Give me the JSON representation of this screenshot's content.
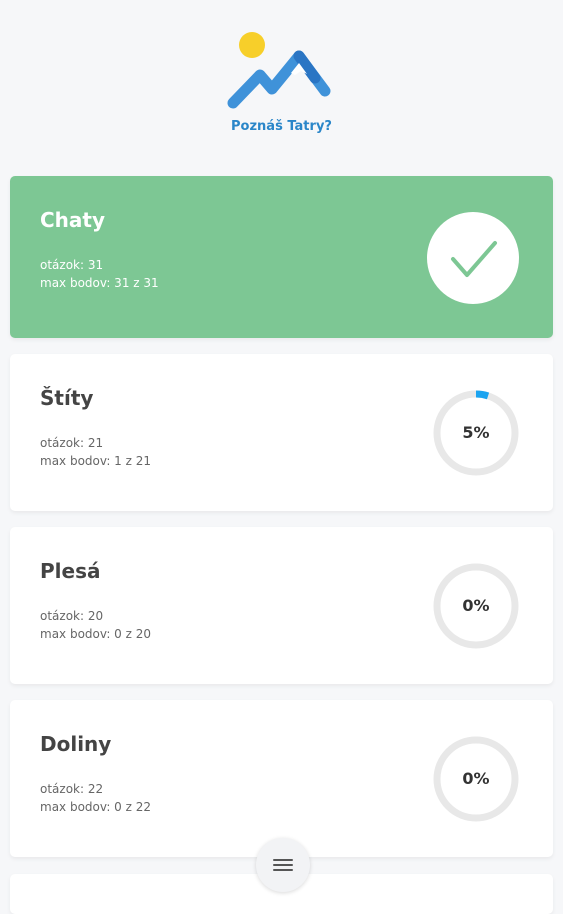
{
  "app": {
    "title": "Poznáš Tatry?"
  },
  "colors": {
    "accent": "#2a86c9",
    "done_card": "#7dc794",
    "check": "#7dc794",
    "progress": "#1aa3f0",
    "ring_track": "#e8e8e8"
  },
  "icons": {
    "logo": "mountain-sun-logo",
    "check": "check-icon",
    "menu": "hamburger-menu-icon"
  },
  "categories": [
    {
      "name": "Chaty",
      "questions": "otázok: 31",
      "points": "max bodov: 31 z 31",
      "completed": true,
      "progress": 1.0
    },
    {
      "name": "Štíty",
      "questions": "otázok: 21",
      "points": "max bodov: 1 z 21",
      "completed": false,
      "progress": 0.05,
      "progress_label": "5%"
    },
    {
      "name": "Plesá",
      "questions": "otázok: 20",
      "points": "max bodov: 0 z 20",
      "completed": false,
      "progress": 0,
      "progress_label": "0%"
    },
    {
      "name": "Doliny",
      "questions": "otázok: 22",
      "points": "max bodov: 0 z 22",
      "completed": false,
      "progress": 0,
      "progress_label": "0%"
    }
  ]
}
